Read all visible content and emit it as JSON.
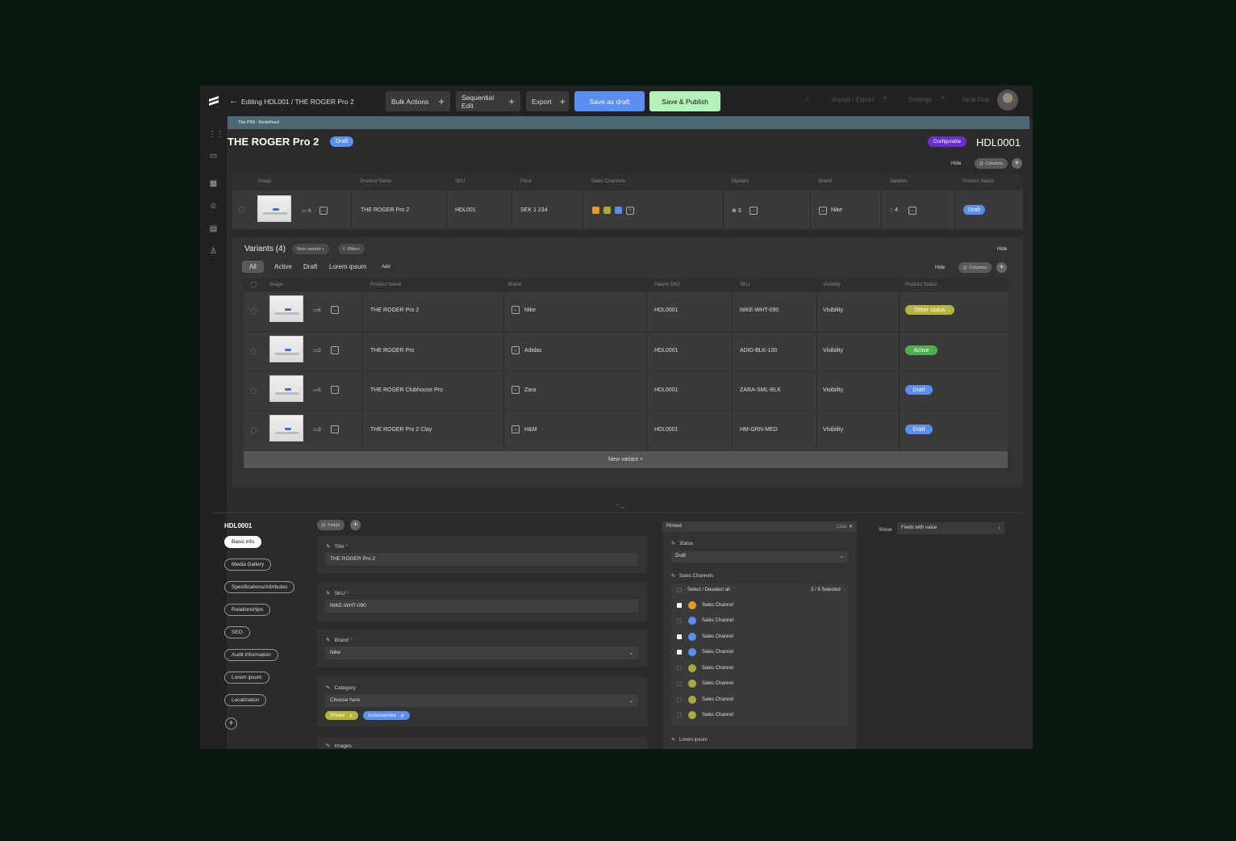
{
  "topbar": {
    "breadcrumb": "Editing HDL001 / THE ROGER Pro 2",
    "bulk_actions": "Bulk Actions",
    "sequential_edit": "Sequential Edit",
    "export": "Export",
    "save_draft": "Save as draft",
    "save_publish": "Save & Publish",
    "import_export": "Import / Export",
    "settings": "Settings",
    "user_name": "Jane Doe"
  },
  "banner": "The PIM - Redefined",
  "product": {
    "title": "THE ROGER Pro 2",
    "status": "Draft",
    "type_badge": "Configurable",
    "code": "HDL0001",
    "hide": "Hide",
    "columns": "Columns",
    "headers": [
      "Image",
      "Product Name",
      "SKU",
      "Price",
      "Sales Channels",
      "Markets",
      "Brand",
      "Variants",
      "Product Status"
    ],
    "row": {
      "image_count": "6",
      "name": "THE ROGER Pro 2",
      "sku": "HDL001",
      "price": "SEK 1 234",
      "markets": "3",
      "brand": "Nike",
      "variants": "4",
      "status": "Draft"
    }
  },
  "variants": {
    "title": "Variants (4)",
    "new_variant": "New variant +",
    "filters": "Filters",
    "hide": "Hide",
    "tabs": [
      "All",
      "Active",
      "Draft",
      "Lorem ipsum"
    ],
    "add": "Add",
    "columns": "Columns",
    "headers": [
      "Image",
      "Product Name",
      "Brand",
      "Parent SKU",
      "SKU",
      "Visibility",
      "Product Status"
    ],
    "rows": [
      {
        "count": "6",
        "name": "THE ROGER Pro 2",
        "brand": "Nike",
        "parent": "HDL0001",
        "sku": "NIKE-WHT-090",
        "visibility": "Visibility",
        "status": "Other status",
        "status_color": "#b5b53a"
      },
      {
        "count": "2",
        "name": "THE ROGER Pro",
        "brand": "Adidas",
        "parent": "HDL0001",
        "sku": "ADID-BLK-100",
        "visibility": "Visibility",
        "status": "Active",
        "status_color": "#4caf50"
      },
      {
        "count": "5",
        "name": "THE ROGER Clubhouse Pro",
        "brand": "Zara",
        "parent": "HDL0001",
        "sku": "ZARA-SML-BLK",
        "visibility": "Visibility",
        "status": "Draft",
        "status_color": "#5a8ef0"
      },
      {
        "count": "3",
        "name": "THE ROGER Pro 2 Clay",
        "brand": "H&M",
        "parent": "HDL0001",
        "sku": "HM-GRN-MED",
        "visibility": "Visibility",
        "status": "Draft",
        "status_color": "#5a8ef0"
      }
    ],
    "new_variant_bar": "New variant +"
  },
  "editor": {
    "code": "HDL0001",
    "nav": [
      "Basic info",
      "Media Gallery",
      "Specifications/Attributes",
      "Relationships",
      "SEO",
      "Audit information",
      "Lorem ipsum",
      "Localization"
    ],
    "fields_btn": "Fields",
    "title_label": "Title",
    "title_value": "THE ROGER Pro 2",
    "sku_label": "SKU",
    "sku_value": "NIKE-WHT-090",
    "brand_label": "Brand",
    "brand_value": "Nike",
    "category_label": "Category",
    "category_placeholder": "Choose here",
    "tags": [
      "Shoes",
      "Accessories"
    ],
    "images_label": "Images"
  },
  "pinned": {
    "title": "Pinned",
    "clear": "Clear",
    "status_label": "Status",
    "status_value": "Draft",
    "sales_label": "Sales Channels",
    "select_all": "Select / Deselect all",
    "selected": "3 / 8 Selected",
    "channel_label": "Sales Channel",
    "lorem": "Lorem ipsum"
  },
  "show": {
    "label": "Show",
    "value": "Fields with value"
  }
}
